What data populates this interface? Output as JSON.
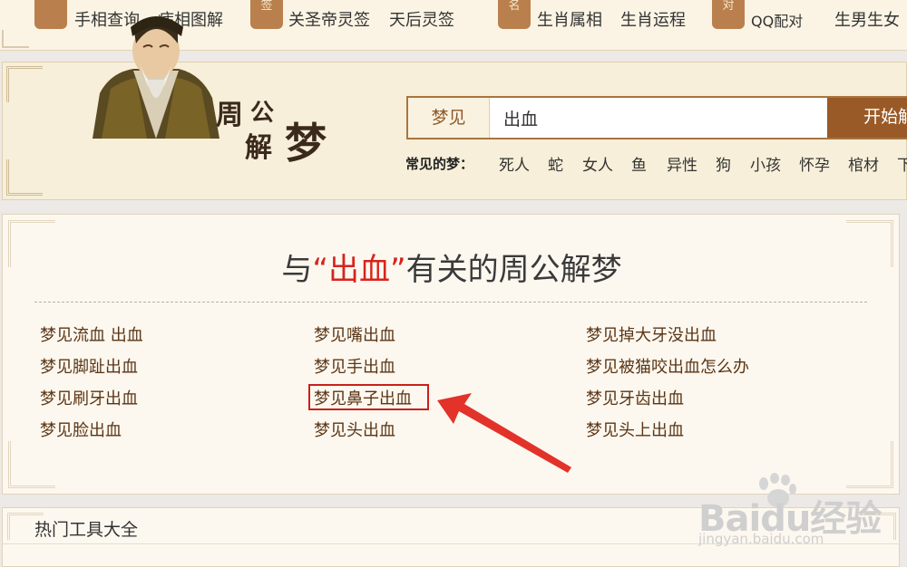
{
  "top_nav": {
    "icons": [
      {
        "name": "palm-icon",
        "glyph": ""
      },
      {
        "name": "qian-icon",
        "glyph": "签"
      },
      {
        "name": "name-icon",
        "glyph": "名"
      },
      {
        "name": "pair-icon",
        "glyph": "对"
      }
    ],
    "links": [
      "手相查询",
      "痣相图解",
      "关圣帝灵签",
      "天后灵签",
      "生肖属相",
      "生肖运程",
      "QQ配对",
      "生男生女"
    ]
  },
  "banner": {
    "logo": [
      "周",
      "公",
      "解",
      "梦"
    ],
    "search_label": "梦见",
    "search_value": "出血",
    "search_button": "开始解梦",
    "common_label": "常见的梦：",
    "common_items": [
      "死人",
      "蛇",
      "女人",
      "鱼",
      "异性",
      "狗",
      "小孩",
      "怀孕",
      "棺材",
      "下"
    ]
  },
  "results": {
    "title_prefix": "与",
    "title_keyword": "“出血”",
    "title_suffix": "有关的周公解梦",
    "columns": [
      [
        "梦见流血 出血",
        "梦见脚趾出血",
        "梦见刷牙出血",
        "梦见脸出血"
      ],
      [
        "梦见嘴出血",
        "梦见手出血",
        "梦见鼻子出血",
        "梦见头出血"
      ],
      [
        "梦见掉大牙没出血",
        "梦见被猫咬出血怎么办",
        "梦见牙齿出血",
        "梦见头上出血"
      ]
    ]
  },
  "tools": {
    "title": "热门工具大全"
  },
  "watermark": {
    "text": "Baidu经验",
    "url": "jingyan.baidu.com"
  },
  "colors": {
    "accent": "#9a5a27",
    "keyword": "#d6241d",
    "highlight": "#c8201c"
  }
}
